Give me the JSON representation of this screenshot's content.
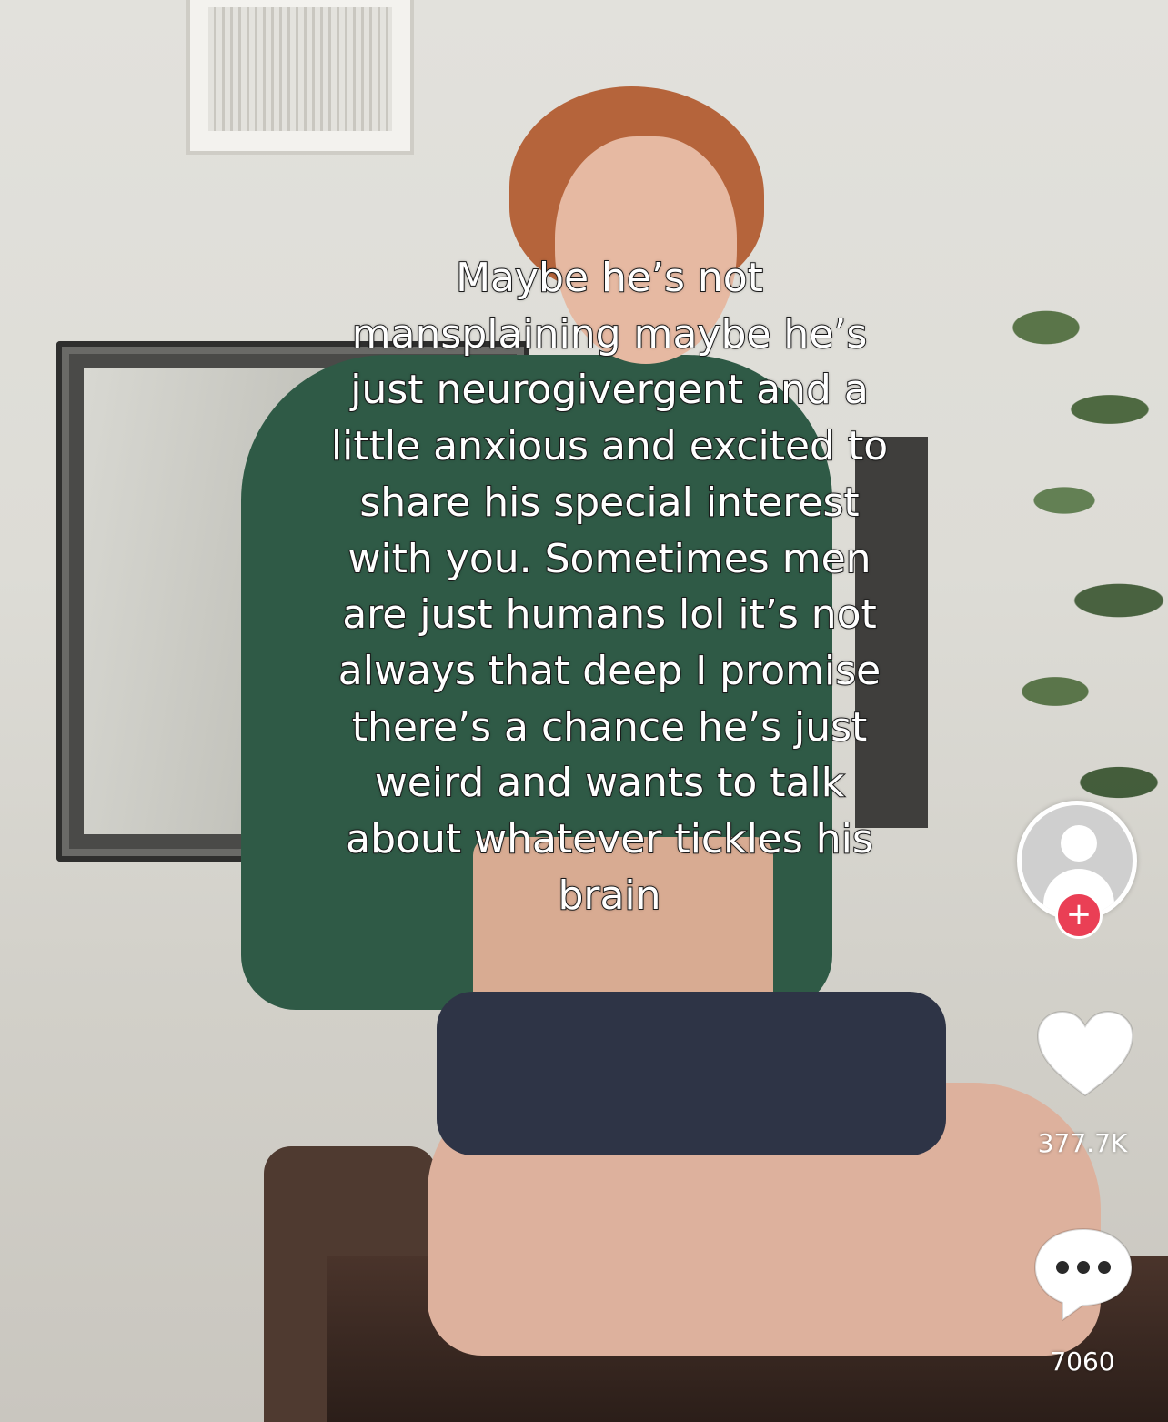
{
  "caption": {
    "lines": [
      "Maybe he’s not",
      "mansplaining maybe he’s",
      "just neurogivergent and a",
      "little anxious and excited to",
      "share his special interest",
      "with you. Sometimes men",
      "are just humans lol it’s not",
      "always that deep I promise",
      "there’s a chance he’s just",
      "weird and wants to talk",
      "about whatever tickles his",
      "brain"
    ]
  },
  "sidebar": {
    "avatar_icon": "default-user-avatar-icon",
    "follow_icon": "plus-icon",
    "follow_symbol": "+",
    "like_icon": "heart-icon",
    "like_count": "377.7K",
    "comment_icon": "comment-bubble-icon",
    "comment_count": "7060"
  },
  "colors": {
    "follow_badge": "#ea3f55",
    "caption_text": "#ffffff",
    "caption_outline": "#1f1f1f"
  }
}
